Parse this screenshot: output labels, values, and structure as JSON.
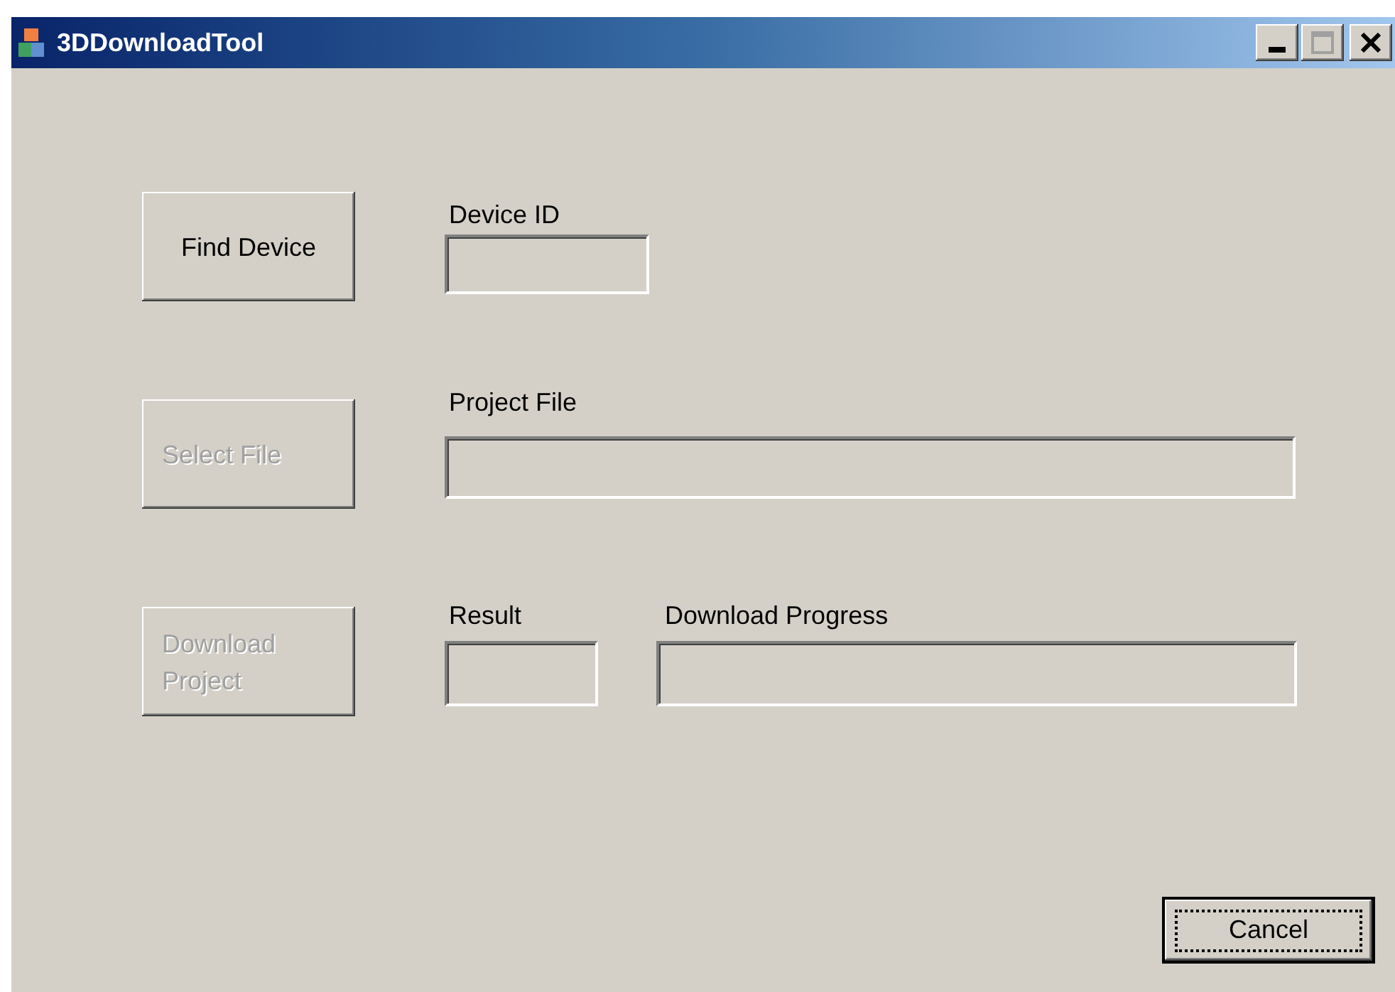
{
  "window": {
    "title": "3DDownloadTool"
  },
  "rows": [
    {
      "button": {
        "label": "Find Device",
        "disabled": false
      },
      "fields": [
        {
          "label": "Device ID"
        }
      ]
    },
    {
      "button": {
        "label": "Select File",
        "disabled": true
      },
      "fields": [
        {
          "label": "Project File"
        }
      ]
    },
    {
      "button": {
        "label": "Download Project",
        "disabled": true
      },
      "fields": [
        {
          "label": "Result"
        },
        {
          "label": "Download Progress"
        }
      ]
    }
  ],
  "cancel_button": {
    "label": "Cancel",
    "focused": true
  }
}
